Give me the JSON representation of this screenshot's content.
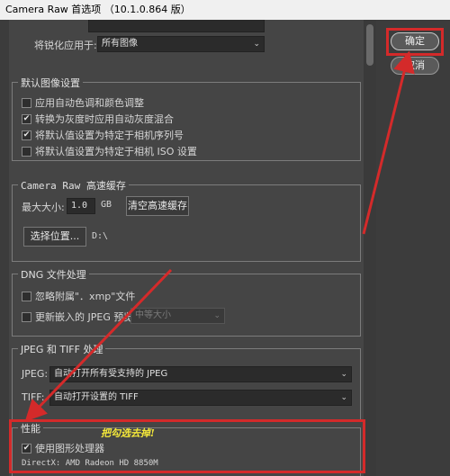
{
  "window": {
    "title": "Camera Raw 首选项 （10.1.0.864 版）"
  },
  "sidebar_buttons": {
    "ok": "确定",
    "cancel": "取消"
  },
  "sharpen": {
    "label": "将锐化应用于:",
    "value": "所有图像"
  },
  "default_settings": {
    "legend": "默认图像设置",
    "options": [
      {
        "label": "应用自动色调和颜色调整",
        "checked": false
      },
      {
        "label": "转换为灰度时应用自动灰度混合",
        "checked": true
      },
      {
        "label": "将默认值设置为特定于相机序列号",
        "checked": true
      },
      {
        "label": "将默认值设置为特定于相机 ISO 设置",
        "checked": false
      }
    ]
  },
  "cache": {
    "legend": "Camera Raw 高速缓存",
    "max_size_label": "最大大小:",
    "max_size_value": "1.0",
    "unit": "GB",
    "purge_button": "清空高速缓存",
    "location_button": "选择位置...",
    "location_value": "D:\\"
  },
  "dng": {
    "legend": "DNG 文件处理",
    "ignore_sidecar": {
      "label": "忽略附属\"．xmp\"文件",
      "checked": false
    },
    "update_preview": {
      "label": "更新嵌入的 JPEG 预览:",
      "checked": false
    },
    "preview_size": "中等大小"
  },
  "jpeg_tiff": {
    "legend": "JPEG 和 TIFF 处理",
    "jpeg_label": "JPEG:",
    "jpeg_value": "自动打开所有受支持的 JPEG",
    "tiff_label": "TIFF:",
    "tiff_value": "自动打开设置的 TIFF"
  },
  "performance": {
    "legend": "性能",
    "gpu_option": {
      "label": "使用图形处理器",
      "checked": true
    },
    "directx_info": "DirectX: AMD Radeon HD 8850M"
  },
  "annotation": {
    "text": "把勾选去掉!"
  },
  "colors": {
    "highlight": "#d42a2a",
    "annotation": "#f5e93a"
  }
}
